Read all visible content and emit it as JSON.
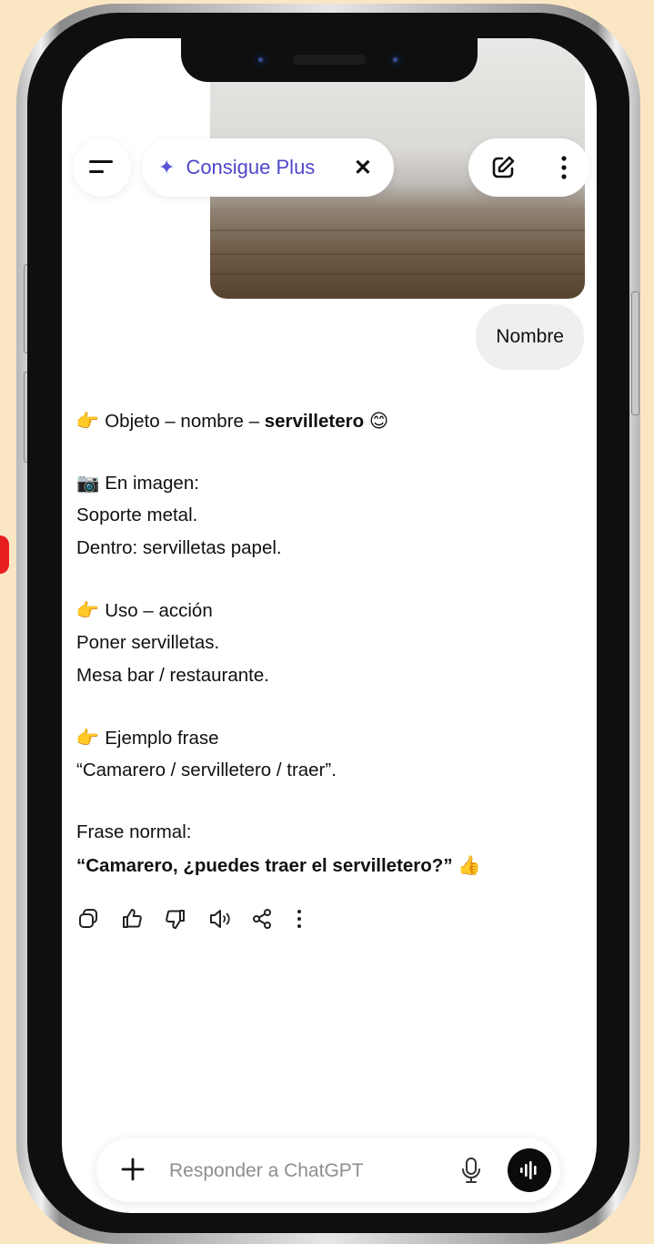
{
  "header": {
    "plus_label": "Consigue Plus",
    "plus_icon": "sparkle-icon",
    "close_symbol": "✕"
  },
  "user_message": "Nombre",
  "reply": {
    "l1_pre": " Objeto – nombre – ",
    "l1_bold": "servilletero",
    "l2": " En imagen:",
    "l3": "Soporte metal.",
    "l4": "Dentro: servilletas papel.",
    "l5": " Uso – acción",
    "l6": "Poner servilletas.",
    "l7": "Mesa bar / restaurante.",
    "l8": " Ejemplo frase",
    "l9": "“Camarero / servilletero / traer”.",
    "l10": "Frase normal:",
    "l11_bold": "“Camarero, ¿puedes traer el servilletero?”"
  },
  "icons": {
    "pointing_hand": "👈",
    "smile": "😊",
    "camera": "📷",
    "thumbs": "👍"
  },
  "composer": {
    "placeholder": "Responder a ChatGPT"
  },
  "colors": {
    "background": "#fbe6c4",
    "accent": "#4f46c9",
    "emoji_yellow": "#f5b400"
  }
}
